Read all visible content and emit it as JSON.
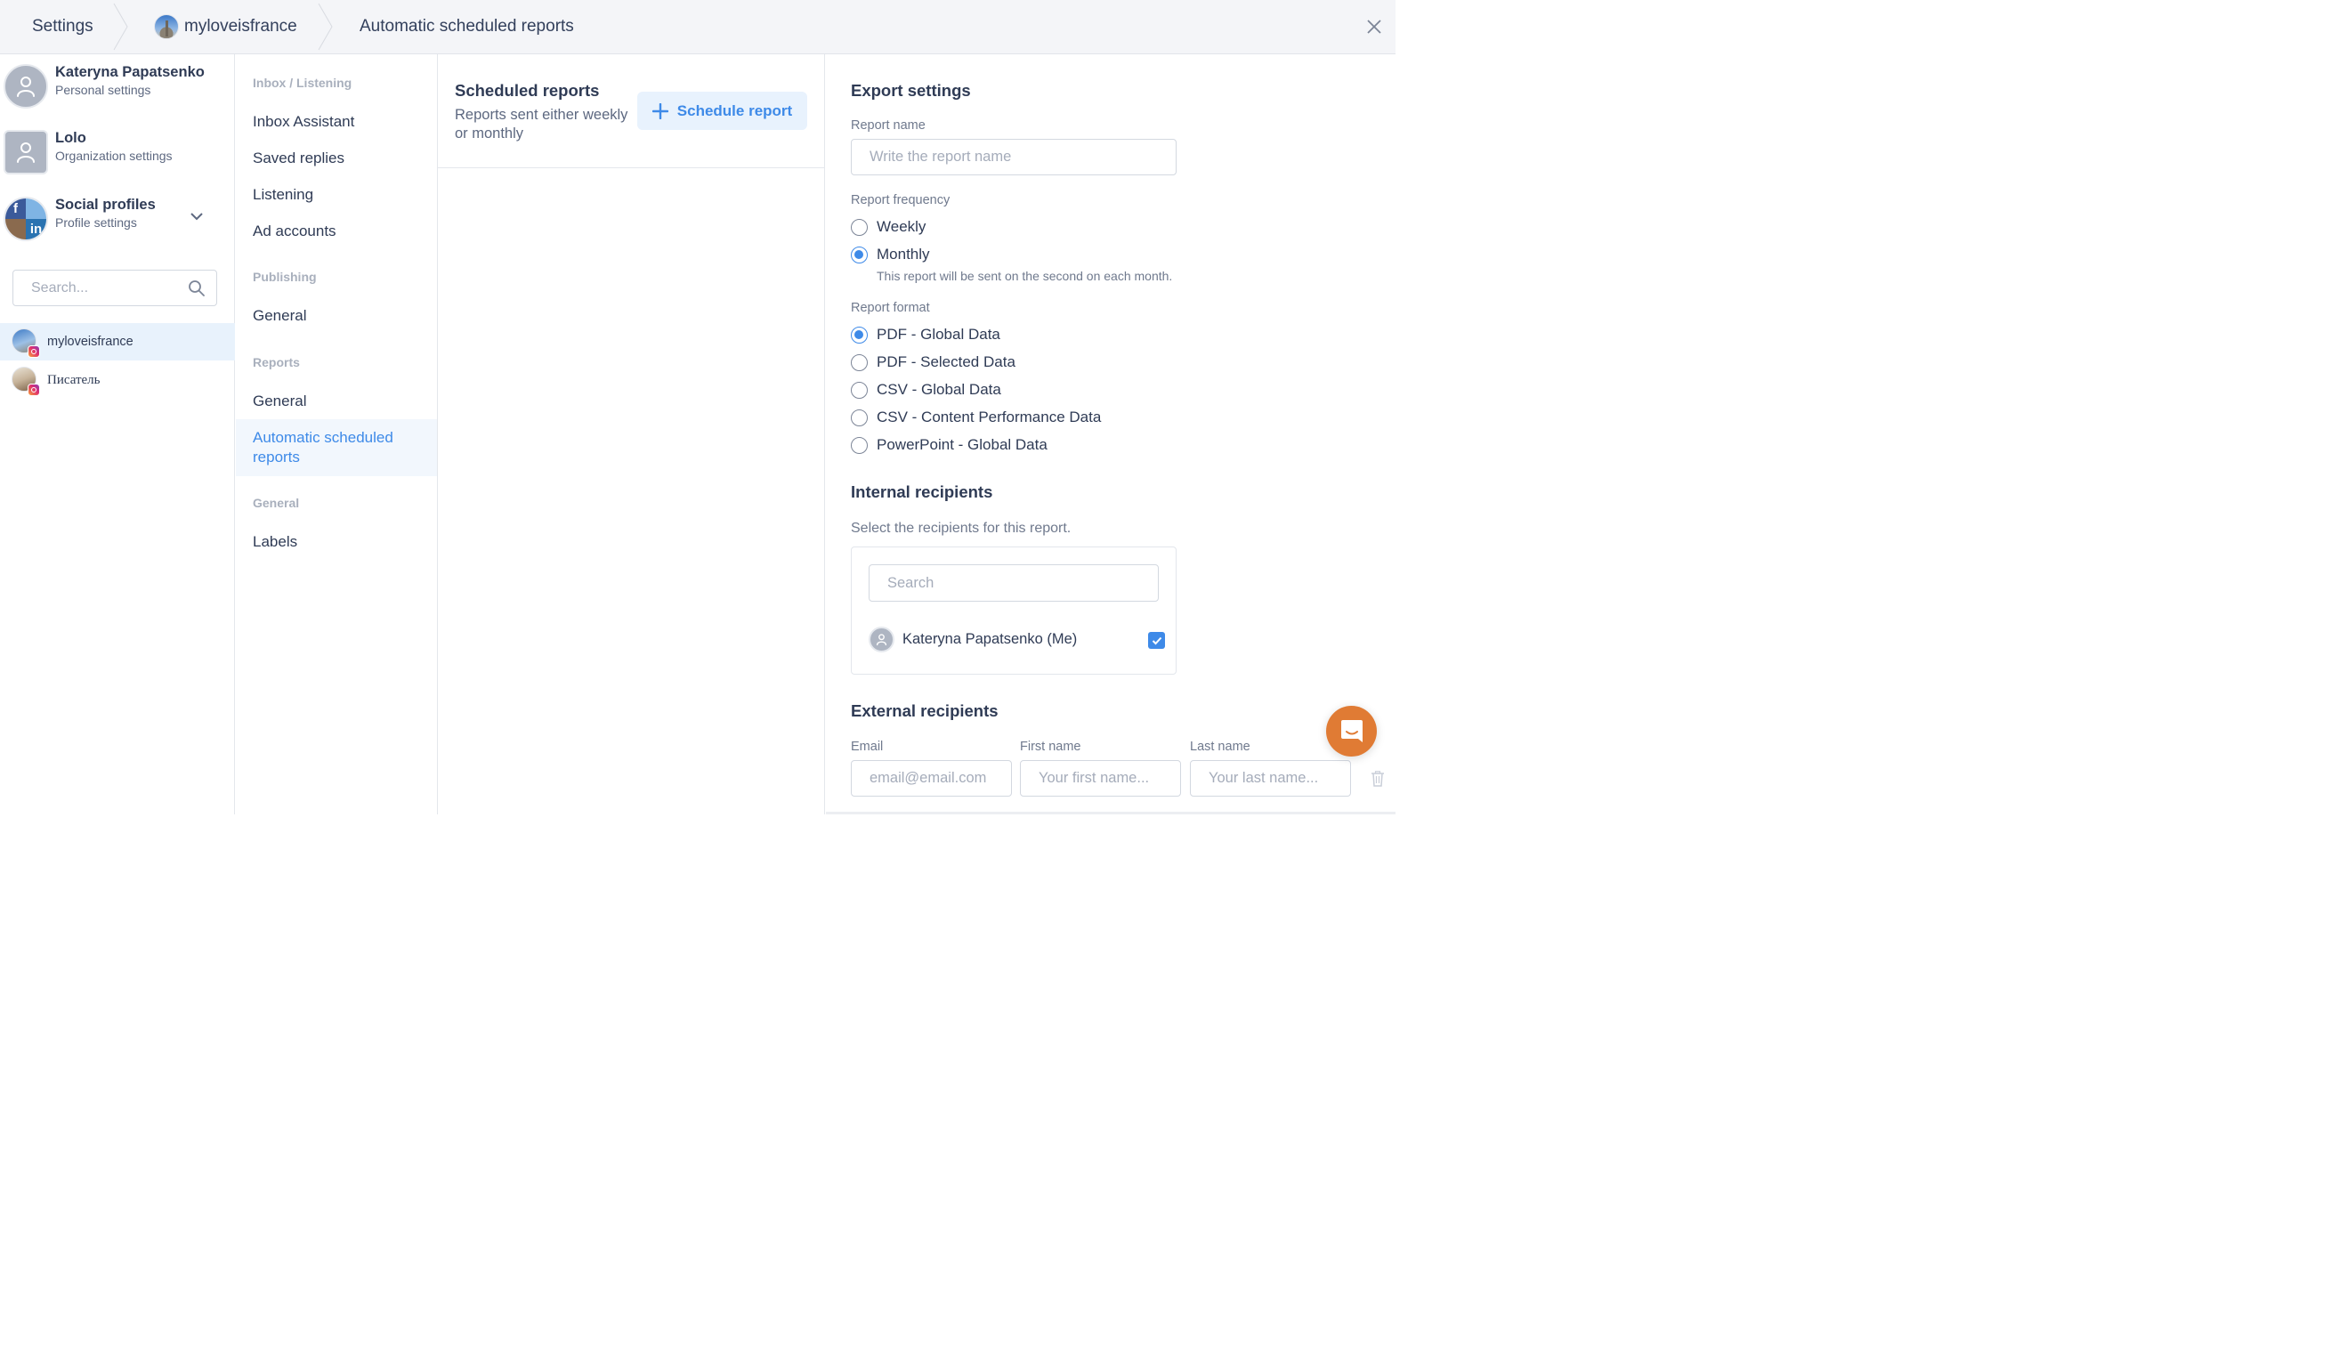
{
  "breadcrumb": {
    "items": [
      {
        "label": "Settings"
      },
      {
        "label": "myloveisfrance",
        "avatar": "profile-photo"
      },
      {
        "label": "Automatic scheduled reports"
      }
    ],
    "close_icon": "close-icon"
  },
  "accounts": [
    {
      "name": "Kateryna Papatsenko",
      "subtitle": "Personal settings",
      "icon": "user-icon"
    },
    {
      "name": "Lolo",
      "subtitle": "Organization settings",
      "icon": "user-icon"
    },
    {
      "name": "Social profiles",
      "subtitle": "Profile settings",
      "icon": "social-networks-icon",
      "expand_icon": "chevron-down-icon"
    }
  ],
  "profile_search": {
    "placeholder": "Search...",
    "value": ""
  },
  "profiles": [
    {
      "name": "myloveisfrance",
      "network": "instagram",
      "active": true
    },
    {
      "name": "Писатель",
      "network": "instagram",
      "active": false
    }
  ],
  "settings_nav": {
    "sections": [
      {
        "heading": "Inbox / Listening",
        "items": [
          "Inbox Assistant",
          "Saved replies",
          "Listening",
          "Ad accounts"
        ]
      },
      {
        "heading": "Publishing",
        "items": [
          "General"
        ]
      },
      {
        "heading": "Reports",
        "items": [
          "General",
          "Automatic scheduled reports"
        ]
      },
      {
        "heading": "General",
        "items": [
          "Labels"
        ]
      }
    ],
    "active_item": "Automatic scheduled reports"
  },
  "scheduled_reports": {
    "title": "Scheduled reports",
    "subtitle": "Reports sent either weekly or monthly",
    "schedule_button": "Schedule report"
  },
  "export_settings": {
    "title": "Export settings",
    "report_name": {
      "label": "Report name",
      "placeholder": "Write the report name",
      "value": ""
    },
    "frequency": {
      "label": "Report frequency",
      "options": [
        "Weekly",
        "Monthly"
      ],
      "selected": "Monthly",
      "hint": "This report will be sent on the second on each month."
    },
    "format": {
      "label": "Report format",
      "options": [
        "PDF - Global Data",
        "PDF - Selected Data",
        "CSV - Global Data",
        "CSV - Content Performance Data",
        "PowerPoint - Global Data"
      ],
      "selected": "PDF - Global Data"
    },
    "internal_recipients": {
      "title": "Internal recipients",
      "description": "Select the recipients for this report.",
      "search_placeholder": "Search",
      "recipients": [
        {
          "name": "Kateryna Papatsenko (Me)",
          "checked": true
        }
      ]
    },
    "external_recipients": {
      "title": "External recipients",
      "email_label": "Email",
      "email_placeholder": "email@email.com",
      "first_name_label": "First name",
      "first_name_placeholder": "Your first name...",
      "last_name_label": "Last name",
      "last_name_placeholder": "Your last name..."
    }
  },
  "colors": {
    "accent": "#3e8ae8",
    "chat_button": "#e07b34",
    "topbar_bg": "#f4f5f8",
    "active_row_bg": "#e8f2fc"
  }
}
